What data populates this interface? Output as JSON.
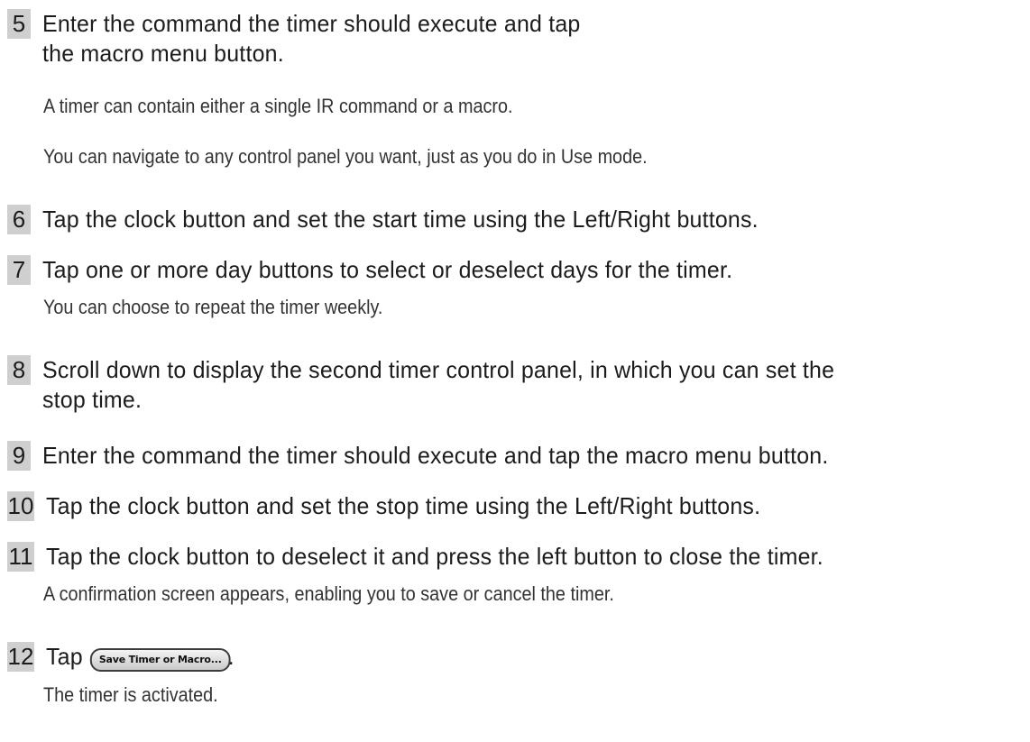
{
  "steps": [
    {
      "number": "5",
      "title_line1": "Enter the command the timer should execute and tap",
      "title_line2": "the macro menu button.",
      "notes": [
        "A timer can contain either a single IR command or a macro.",
        "You can navigate to any control panel you want, just as you do in Use mode."
      ]
    },
    {
      "number": "6",
      "title": "Tap the clock button and set the start time using the Left/Right buttons."
    },
    {
      "number": "7",
      "title": "Tap one or more day buttons to select or deselect days for the timer.",
      "notes": [
        "You can choose to repeat the timer weekly."
      ]
    },
    {
      "number": "8",
      "title_line1": "Scroll down to display the second timer control panel, in which you can set the",
      "title_line2": "stop time."
    },
    {
      "number": "9",
      "title": "Enter the command the timer should execute and tap the macro menu button."
    },
    {
      "number": "10",
      "title": "Tap the clock button and set the stop time using the Left/Right buttons."
    },
    {
      "number": "11",
      "title": "Tap the clock button to deselect it and press the left button to close the timer.",
      "notes": [
        "A confirmation screen appears, enabling you to save or cancel the timer."
      ]
    },
    {
      "number": "12",
      "title_prefix": "Tap",
      "button_label": "Save Timer or Macro...",
      "title_suffix": ".",
      "notes": [
        "The timer is activated."
      ]
    }
  ]
}
